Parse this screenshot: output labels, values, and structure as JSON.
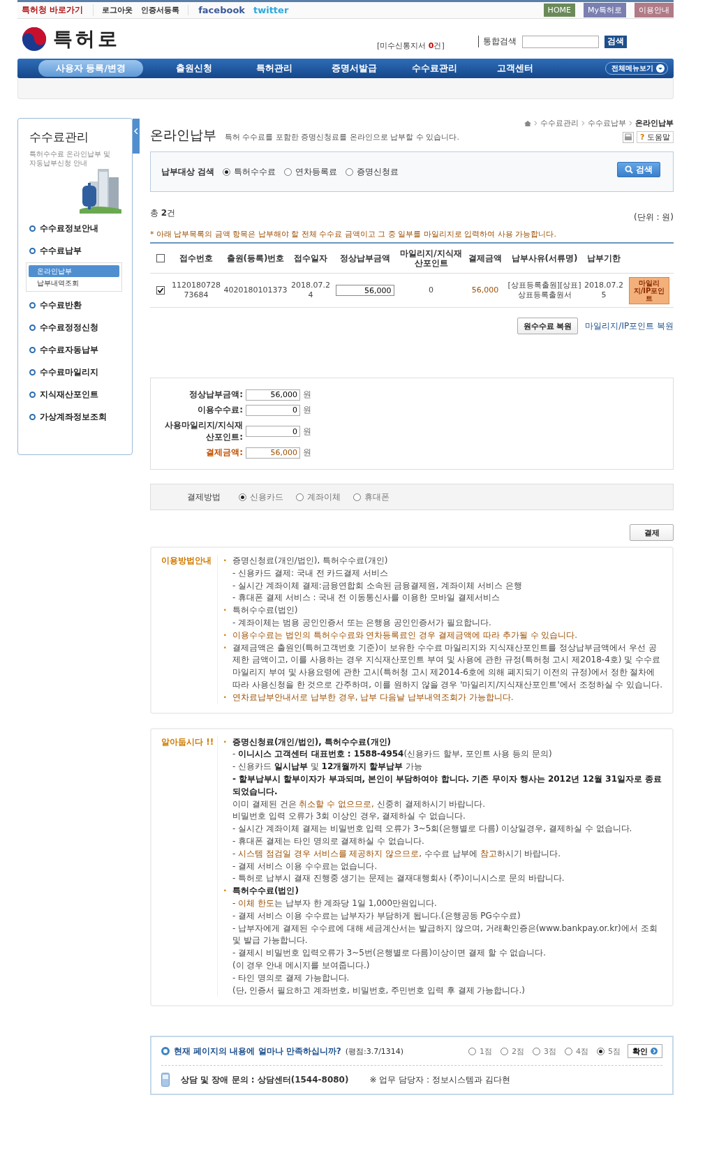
{
  "top_bar": {
    "shortcut": "특허청 바로가기",
    "links": [
      "로그아웃",
      "인증서등록"
    ],
    "social": [
      "facebook",
      "twitter"
    ],
    "buttons": [
      {
        "label": "HOME",
        "kind": "home"
      },
      {
        "label": "My특허로",
        "kind": "my"
      },
      {
        "label": "이용안내",
        "kind": "guide"
      }
    ]
  },
  "header": {
    "logo": "특허로",
    "notice_prefix": "[미수신통지서 ",
    "notice_count": "0",
    "notice_suffix": "건]",
    "search_label": "통합검색",
    "search_button": "검색"
  },
  "nav": {
    "items": [
      {
        "label": "사용자 등록/변경",
        "selected": true
      },
      {
        "label": "출원신청",
        "selected": false
      },
      {
        "label": "특허관리",
        "selected": false
      },
      {
        "label": "증명서발급",
        "selected": false
      },
      {
        "label": "수수료관리",
        "selected": false
      },
      {
        "label": "고객센터",
        "selected": false
      }
    ],
    "all_menu": "전체메뉴보기"
  },
  "sidebar": {
    "title": "수수료관리",
    "description": "특허수수료 온라인납부 및 자동납부신청 안내",
    "items": [
      {
        "label": "수수료정보안내"
      },
      {
        "label": "수수료납부",
        "children": [
          {
            "label": "온라인납부",
            "selected": true
          },
          {
            "label": "납부내역조회",
            "selected": false
          }
        ]
      },
      {
        "label": "수수료반환"
      },
      {
        "label": "수수료정정신청"
      },
      {
        "label": "수수료자동납부"
      },
      {
        "label": "수수료마일리지"
      },
      {
        "label": "지식재산포인트"
      },
      {
        "label": "가상계좌정보조회"
      }
    ]
  },
  "page": {
    "breadcrumb": [
      "수수료관리",
      "수수료납부",
      "온라인납부"
    ],
    "help": "도움말",
    "help_mark": "?",
    "title": "온라인납부",
    "description": "특허 수수료를 포함한 증명신청료를 온라인으로 납부할 수 있습니다."
  },
  "search": {
    "label": "납부대상 검색",
    "options": [
      {
        "label": "특허수수료",
        "selected": true
      },
      {
        "label": "연차등록료",
        "selected": false
      },
      {
        "label": "증명신청료",
        "selected": false
      }
    ],
    "button": "검색"
  },
  "list": {
    "total_prefix": "총 ",
    "total_count": "2",
    "total_suffix": "건",
    "unit": "(단위 : 원)",
    "note": "* 아래 납부목록의 금액 항목은 납부해야 할 전체 수수료 금액이고 그 중 일부를 마일리지로 입력하여 사용 가능합니다.",
    "all_checked": false,
    "columns": [
      "접수번호",
      "출원(등록)번호",
      "접수일자",
      "정상납부금액",
      "마일리지/지식재산포인트",
      "결제금액",
      "납부사유(서류명)",
      "납부기한"
    ],
    "rows": [
      {
        "checked": true,
        "receipt_no": "112018072873684",
        "application_no": "4020180101373",
        "date": "2018.07.24",
        "amount": "56,000",
        "points": "0",
        "payment": "56,000",
        "reason": "[상표등록출원][상표]상표등록출원서",
        "due": "2018.07.25",
        "action": "마일리지/IP포인트"
      }
    ],
    "restore_button": "원수수료 복원",
    "restore_link": "마일리지/IP포인트 복원"
  },
  "summary": [
    {
      "label": "정상납부금액:",
      "value": "56,000",
      "unit": "원",
      "kind": "plain"
    },
    {
      "label": "이용수수료:",
      "value": "0",
      "unit": "원",
      "kind": "plain"
    },
    {
      "label": "사용마일리지/지식재산포인트:",
      "value": "0",
      "unit": "원",
      "kind": "plain"
    },
    {
      "label": "결제금액:",
      "value": "56,000",
      "unit": "원",
      "kind": "total"
    }
  ],
  "payment_method": {
    "label": "결제방법",
    "options": [
      {
        "label": "신용카드",
        "selected": true
      },
      {
        "label": "계좌이체",
        "selected": false
      },
      {
        "label": "휴대폰",
        "selected": false
      }
    ],
    "button": "결제"
  },
  "info_boxes": [
    {
      "title": "이용방법안내",
      "lines": [
        {
          "marker": "·",
          "parts": [
            {
              "text": "증명신청료(개인/법인), 특허수수료(개인)",
              "kind": "plain"
            }
          ]
        },
        {
          "parts": [
            {
              "text": "- 신용카드 결제: 국내 전 카드결제 서비스",
              "kind": "plain"
            }
          ]
        },
        {
          "parts": [
            {
              "text": "- 실시간 계좌이체 결제:금융연합회 소속된 금융결제원, 계좌이체 서비스 은행",
              "kind": "plain"
            }
          ]
        },
        {
          "parts": [
            {
              "text": "- 휴대폰 결제 서비스 : 국내 전 이동통신사를 이용한 모바일 결제서비스",
              "kind": "plain"
            }
          ]
        },
        {
          "marker": "·",
          "parts": [
            {
              "text": "특허수수료(법인)",
              "kind": "plain"
            }
          ]
        },
        {
          "parts": [
            {
              "text": "- 계좌이체는 범용 공인인증서 또는 은행용 공인인증서가 필요합니다.",
              "kind": "plain"
            }
          ]
        },
        {
          "marker": "·",
          "parts": [
            {
              "text": "이용수수료는 법인의 특허수수료와 연차등록료인 경우 결제금액에 따라 추가될 수 있습니다.",
              "kind": "accent"
            }
          ]
        },
        {
          "marker": "·",
          "parts": [
            {
              "text": "결제금액은 출원인(특허고객번호 기준)이 보유한 수수료 마일리지와 지식재산포인트를 정상납부금액에서 우선 공제한 금액이고, 이를 사용하는 경우 지식재산포인트 부여 및 사용에 관한 규정(특허청 고시 제2018-4호) 및 수수료 마일리지 부여 및 사용요령에 관한 고시(특허청 고시 제2014-6호에 의해 폐지되기 이전의 규정)에서 정한 절차에 따라 사용신청을 한 것으로 간주하며, 이를 원하지 않을 경우 '마일리지/지식재산포인트'에서 조정하실 수 있습니다.",
              "kind": "plain"
            }
          ]
        },
        {
          "marker": "·",
          "parts": [
            {
              "text": "연차료납부안내서로 납부한 경우, 납부 다음날 납부내역조회가 가능합니다.",
              "kind": "accent"
            }
          ]
        }
      ]
    },
    {
      "title": "알아둡시다 !!",
      "lines": [
        {
          "marker": "·",
          "parts": [
            {
              "text": "증명신청료(개인/법인), 특허수수료(개인)",
              "kind": "strong"
            }
          ]
        },
        {
          "parts": [
            {
              "text": "- ",
              "kind": "plain"
            },
            {
              "text": "이니시스 고객센터 대표번호 : 1588-4954",
              "kind": "strong"
            },
            {
              "text": "(신용카드 할부, 포인트 사용 등의 문의)",
              "kind": "plain"
            }
          ]
        },
        {
          "parts": [
            {
              "text": "- 신용카드 ",
              "kind": "plain"
            },
            {
              "text": "일시납부",
              "kind": "strong"
            },
            {
              "text": " 및 ",
              "kind": "plain"
            },
            {
              "text": "12개월까지 할부납부",
              "kind": "strong"
            },
            {
              "text": " 가능",
              "kind": "plain"
            }
          ]
        },
        {
          "parts": [
            {
              "text": "- 할부납부시 할부이자가 부과되며, 본인이 부담하여야 합니다. 기존 무이자 행사는 2012년 12월 31일자로 종료되었습니다.",
              "kind": "strong"
            }
          ]
        },
        {
          "parts": [
            {
              "text": "이미 결제된 건은 ",
              "kind": "plain"
            },
            {
              "text": "취소할 수 없으므로,",
              "kind": "accent"
            },
            {
              "text": " 신중히 결제하시기 바랍니다.",
              "kind": "plain"
            }
          ]
        },
        {
          "parts": [
            {
              "text": "비밀번호 입력 오류가 3회 이상인 경우, 결제하실 수 없습니다.",
              "kind": "plain"
            }
          ]
        },
        {
          "parts": [
            {
              "text": "- 실시간 계좌이체 결제는 비밀번호 입력 오류가 3~5회(은행별로 다름) 이상일경우, 결제하실 수 없습니다.",
              "kind": "plain"
            }
          ]
        },
        {
          "parts": [
            {
              "text": "- 휴대폰 결제는 타인 명의로 결제하실 수 없습니다.",
              "kind": "plain"
            }
          ]
        },
        {
          "parts": [
            {
              "text": "- ",
              "kind": "plain"
            },
            {
              "text": "시스템 점검일 경우 서비스를 제공하지 않으므로,",
              "kind": "accent"
            },
            {
              "text": " 수수료 납부에 ",
              "kind": "plain"
            },
            {
              "text": "참고",
              "kind": "accent"
            },
            {
              "text": "하시기 바랍니다.",
              "kind": "plain"
            }
          ]
        },
        {
          "parts": [
            {
              "text": "- 결제 서비스 이용 수수료는 없습니다.",
              "kind": "plain"
            }
          ]
        },
        {
          "parts": [
            {
              "text": "- 특허로 납부시 결재 진행중 생기는 문제는 결재대행회사 (주)이니시스로 문의 바랍니다.",
              "kind": "plain"
            }
          ]
        },
        {
          "marker": "·",
          "parts": [
            {
              "text": "특허수수료(법인)",
              "kind": "strong"
            }
          ]
        },
        {
          "parts": [
            {
              "text": "- ",
              "kind": "plain"
            },
            {
              "text": "이체 한도",
              "kind": "accent"
            },
            {
              "text": "는 납부자 한 계좌당 1일 1,000만원입니다.",
              "kind": "plain"
            }
          ]
        },
        {
          "parts": [
            {
              "text": "- 결제 서비스 이용 수수료는 납부자가 부담하게 됩니다.(은행공동 PG수수료)",
              "kind": "plain"
            }
          ]
        },
        {
          "parts": [
            {
              "text": "- 납부자에게 결제된 수수료에 대해 세금계산서는 발급하지 않으며, 거래확인증은(www.bankpay.or.kr)에서 조회 및 발급 가능합니다.",
              "kind": "plain"
            }
          ]
        },
        {
          "parts": [
            {
              "text": "- 결제시 비밀번호 입력오류가 3~5번(은행별로 다름)이상이면 결제 할 수 없습니다.",
              "kind": "plain"
            }
          ]
        },
        {
          "parts": [
            {
              "text": "(이 경우 안내 메시지를 보여줍니다.)",
              "kind": "plain"
            }
          ]
        },
        {
          "parts": [
            {
              "text": "- 타인 명의로 결제 가능합니다.",
              "kind": "plain"
            }
          ]
        },
        {
          "parts": [
            {
              "text": "(단, 인증서 필요하고 계좌번호, 비밀번호, 주민번호 입력 후 결제 가능합니다.)",
              "kind": "plain"
            }
          ]
        }
      ]
    }
  ],
  "survey": {
    "question": "현재 페이지의 내용에 얼마나 만족하십니까?",
    "rating": "(평점:3.7/1314)",
    "options": [
      {
        "label": "1점",
        "selected": false
      },
      {
        "label": "2점",
        "selected": false
      },
      {
        "label": "3점",
        "selected": false
      },
      {
        "label": "4점",
        "selected": false
      },
      {
        "label": "5점",
        "selected": true
      }
    ],
    "button": "확인",
    "contact": "상담 및 장애 문의 : 상담센터(1544-8080)",
    "manager": "※ 업무 담당자 : 정보시스템과 김다현"
  }
}
